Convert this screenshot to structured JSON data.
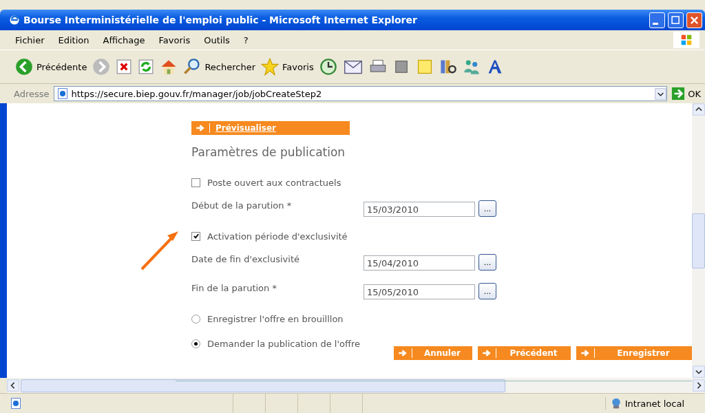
{
  "window": {
    "title": "Bourse Interministérielle de l'emploi public - Microsoft Internet Explorer"
  },
  "menu": [
    "Fichier",
    "Edition",
    "Affichage",
    "Favoris",
    "Outils",
    "?"
  ],
  "toolbar": [
    {
      "kind": "back",
      "label": "Précédente"
    },
    {
      "kind": "forward"
    },
    {
      "kind": "stop"
    },
    {
      "kind": "refresh"
    },
    {
      "kind": "home"
    },
    {
      "kind": "search",
      "label": "Rechercher"
    },
    {
      "kind": "favorites",
      "label": "Favoris"
    },
    {
      "kind": "history"
    },
    {
      "kind": "mail"
    },
    {
      "kind": "print"
    },
    {
      "kind": "edit"
    },
    {
      "kind": "note"
    },
    {
      "kind": "research"
    },
    {
      "kind": "messenger"
    },
    {
      "kind": "font"
    }
  ],
  "address_bar": {
    "label": "Adresse",
    "url": "https://secure.biep.gouv.fr/manager/job/jobCreateStep2",
    "go": "OK"
  },
  "form": {
    "preview_link": "Prévisualiser",
    "heading": "Paramètres de publication",
    "fields": [
      {
        "kind": "checkbox",
        "label": "Poste ouvert aux contractuels",
        "checked": false
      },
      {
        "kind": "date",
        "label": "Début de la parution *",
        "value": "15/03/2010",
        "button": "..."
      },
      {
        "kind": "checkbox",
        "label": "Activation période d'exclusivité",
        "checked": true
      },
      {
        "kind": "date",
        "label": "Date de fin d'exclusivité",
        "value": "15/04/2010",
        "button": "..."
      },
      {
        "kind": "date",
        "label": "Fin de la parution *",
        "value": "15/05/2010",
        "button": "..."
      },
      {
        "kind": "radio",
        "label": "Enregistrer l'offre en brouilllon",
        "selected": false
      },
      {
        "kind": "radio",
        "label": "Demander la publication de l'offre",
        "selected": true
      }
    ],
    "buttons": [
      "Annuler",
      "Précédent",
      "Enregistrer"
    ]
  },
  "status_bar": {
    "zone": "Intranet local"
  }
}
